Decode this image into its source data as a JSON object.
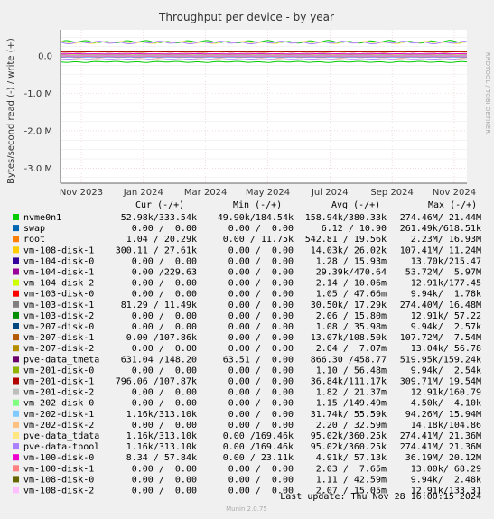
{
  "chart_data": {
    "type": "line",
    "title": "Throughput per device - by year",
    "ylabel": "Bytes/second read (-) / write (+)",
    "y_ticks": [
      "0.0",
      "-1.0 M",
      "-2.0 M",
      "-3.0 M"
    ],
    "y_tick_values": [
      0,
      -1000000,
      -2000000,
      -3000000
    ],
    "ylim": [
      -3400000,
      700000
    ],
    "x_ticks": [
      "Nov 2023",
      "Jan 2024",
      "Mar 2024",
      "May 2024",
      "Jul 2024",
      "Sep 2024",
      "Nov 2024"
    ],
    "side_label": "RRDTOOL / TOBI OETIKER",
    "version": "Munin 2.0.75",
    "legend_header": {
      "cur": "Cur (-/+)",
      "min": "Min (-/+)",
      "avg": "Avg (-/+)",
      "max": "Max (-/+)"
    },
    "series": [
      {
        "name": "nvme0n1",
        "color": "#00cc00",
        "cur": "52.98k/333.54k",
        "min": "49.90k/184.54k",
        "avg": "158.94k/380.33k",
        "max": "274.46M/ 21.44M"
      },
      {
        "name": "swap",
        "color": "#0066b3",
        "cur": "0.00 /  0.00",
        "min": "0.00 /  0.00",
        "avg": "6.12 / 10.90",
        "max": "261.49k/618.51k"
      },
      {
        "name": "root",
        "color": "#ff8000",
        "cur": "1.04 / 20.29k",
        "min": "0.00 / 11.75k",
        "avg": "542.81 / 19.56k",
        "max": "2.23M/ 16.93M"
      },
      {
        "name": "vm-108-disk-1",
        "color": "#ffcc00",
        "cur": "300.11 / 27.61k",
        "min": "0.00 /  0.00",
        "avg": "14.03k/ 26.02k",
        "max": "107.41M/ 11.24M"
      },
      {
        "name": "vm-104-disk-0",
        "color": "#330099",
        "cur": "0.00 /  0.00",
        "min": "0.00 /  0.00",
        "avg": "1.28 / 15.93m",
        "max": "13.70k/215.47"
      },
      {
        "name": "vm-104-disk-1",
        "color": "#990099",
        "cur": "0.00 /229.63",
        "min": "0.00 /  0.00",
        "avg": "29.39k/470.64",
        "max": "53.72M/  5.97M"
      },
      {
        "name": "vm-104-disk-2",
        "color": "#ccff00",
        "cur": "0.00 /  0.00",
        "min": "0.00 /  0.00",
        "avg": "2.14 / 10.06m",
        "max": "12.91k/177.45"
      },
      {
        "name": "vm-103-disk-0",
        "color": "#ff0000",
        "cur": "0.00 /  0.00",
        "min": "0.00 /  0.00",
        "avg": "1.05 / 47.66m",
        "max": "9.94k/  1.78k"
      },
      {
        "name": "vm-103-disk-1",
        "color": "#808080",
        "cur": "81.29 / 11.49k",
        "min": "0.00 /  0.00",
        "avg": "30.50k/ 17.29k",
        "max": "274.40M/ 16.48M"
      },
      {
        "name": "vm-103-disk-2",
        "color": "#008f00",
        "cur": "0.00 /  0.00",
        "min": "0.00 /  0.00",
        "avg": "2.06 / 15.80m",
        "max": "12.91k/ 57.22"
      },
      {
        "name": "vm-207-disk-0",
        "color": "#00487d",
        "cur": "0.00 /  0.00",
        "min": "0.00 /  0.00",
        "avg": "1.08 / 35.98m",
        "max": "9.94k/  2.57k"
      },
      {
        "name": "vm-207-disk-1",
        "color": "#b35a00",
        "cur": "0.00 /107.86k",
        "min": "0.00 /  0.00",
        "avg": "13.07k/108.50k",
        "max": "107.72M/  7.54M"
      },
      {
        "name": "vm-207-disk-2",
        "color": "#b38f00",
        "cur": "0.00 /  0.00",
        "min": "0.00 /  0.00",
        "avg": "2.04 /  7.07m",
        "max": "13.04k/ 56.78"
      },
      {
        "name": "pve-data_tmeta",
        "color": "#6b006b",
        "cur": "631.04 /148.20",
        "min": "63.51 /  0.00",
        "avg": "866.30 /458.77",
        "max": "519.95k/159.24k"
      },
      {
        "name": "vm-201-disk-0",
        "color": "#8fb300",
        "cur": "0.00 /  0.00",
        "min": "0.00 /  0.00",
        "avg": "1.10 / 56.48m",
        "max": "9.94k/  2.54k"
      },
      {
        "name": "vm-201-disk-1",
        "color": "#b30000",
        "cur": "796.06 /107.87k",
        "min": "0.00 /  0.00",
        "avg": "36.84k/111.17k",
        "max": "309.71M/ 19.54M"
      },
      {
        "name": "vm-201-disk-2",
        "color": "#bebebe",
        "cur": "0.00 /  0.00",
        "min": "0.00 /  0.00",
        "avg": "1.82 / 21.37m",
        "max": "12.91k/160.79"
      },
      {
        "name": "vm-202-disk-0",
        "color": "#80ff80",
        "cur": "0.00 /  0.00",
        "min": "0.00 /  0.00",
        "avg": "1.15 /149.49m",
        "max": "4.50k/  4.10k"
      },
      {
        "name": "vm-202-disk-1",
        "color": "#80c9ff",
        "cur": "1.16k/313.10k",
        "min": "0.00 /  0.00",
        "avg": "31.74k/ 55.59k",
        "max": "94.26M/ 15.94M"
      },
      {
        "name": "vm-202-disk-2",
        "color": "#ffc080",
        "cur": "0.00 /  0.00",
        "min": "0.00 /  0.00",
        "avg": "2.20 / 32.59m",
        "max": "14.18k/104.86"
      },
      {
        "name": "pve-data_tdata",
        "color": "#ffe680",
        "cur": "1.16k/313.10k",
        "min": "0.00 /169.46k",
        "avg": "95.02k/360.25k",
        "max": "274.41M/ 21.36M"
      },
      {
        "name": "pve-data-tpool",
        "color": "#aa80ff",
        "cur": "1.16k/313.10k",
        "min": "0.00 /169.46k",
        "avg": "95.02k/360.25k",
        "max": "274.41M/ 21.36M"
      },
      {
        "name": "vm-100-disk-0",
        "color": "#ee00cc",
        "cur": "8.34 / 57.84k",
        "min": "0.00 / 23.11k",
        "avg": "4.91k/ 57.13k",
        "max": "36.19M/ 20.12M"
      },
      {
        "name": "vm-100-disk-1",
        "color": "#ff8080",
        "cur": "0.00 /  0.00",
        "min": "0.00 /  0.00",
        "avg": "2.03 /  7.65m",
        "max": "13.00k/ 68.29"
      },
      {
        "name": "vm-108-disk-0",
        "color": "#666600",
        "cur": "0.00 /  0.00",
        "min": "0.00 /  0.00",
        "avg": "1.11 / 42.59m",
        "max": "9.94k/  2.48k"
      },
      {
        "name": "vm-108-disk-2",
        "color": "#ffbfff",
        "cur": "0.00 /  0.00",
        "min": "0.00 /  0.00",
        "avg": "2.07 / 15.05m",
        "max": "12.91k/133.31"
      }
    ]
  },
  "last_update": "Last update: Thu Nov 28 16:00:15 2024"
}
